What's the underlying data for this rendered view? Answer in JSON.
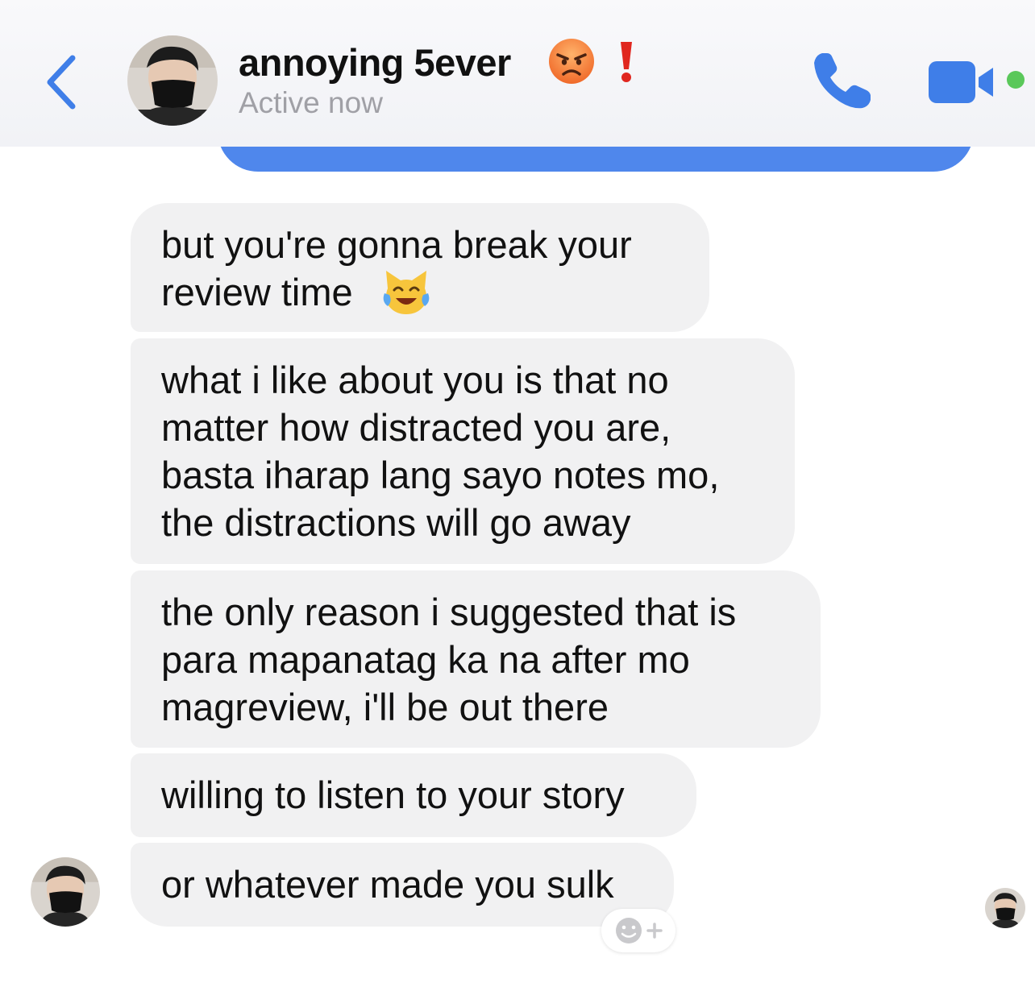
{
  "header": {
    "contact_name": "annoying 5ever",
    "status": "Active now",
    "icons": {
      "back": "chevron-left-icon",
      "call": "phone-icon",
      "video": "video-camera-icon",
      "name_emoji": "angry-face-emoji",
      "name_mark": "exclamation-mark-emoji"
    }
  },
  "messages": [
    {
      "line1": "but you're gonna break your",
      "line2": "review time",
      "emoji": "cat-tears-of-joy-emoji"
    },
    {
      "line1": "what i like about you is that no",
      "line2": "matter how distracted you are,",
      "line3": "basta iharap lang sayo notes mo,",
      "line4": "the distractions will go away"
    },
    {
      "line1": "the only reason i suggested that is",
      "line2": "para mapanatag ka na after mo",
      "line3": "magreview, i'll be out there"
    },
    {
      "line1": "willing to listen to your story"
    },
    {
      "line1": "or whatever made you sulk"
    }
  ],
  "colors": {
    "accent": "#4f87ec",
    "received_bubble": "#f1f1f2",
    "online": "#5ac85a",
    "status_text": "#a0a0a6"
  }
}
